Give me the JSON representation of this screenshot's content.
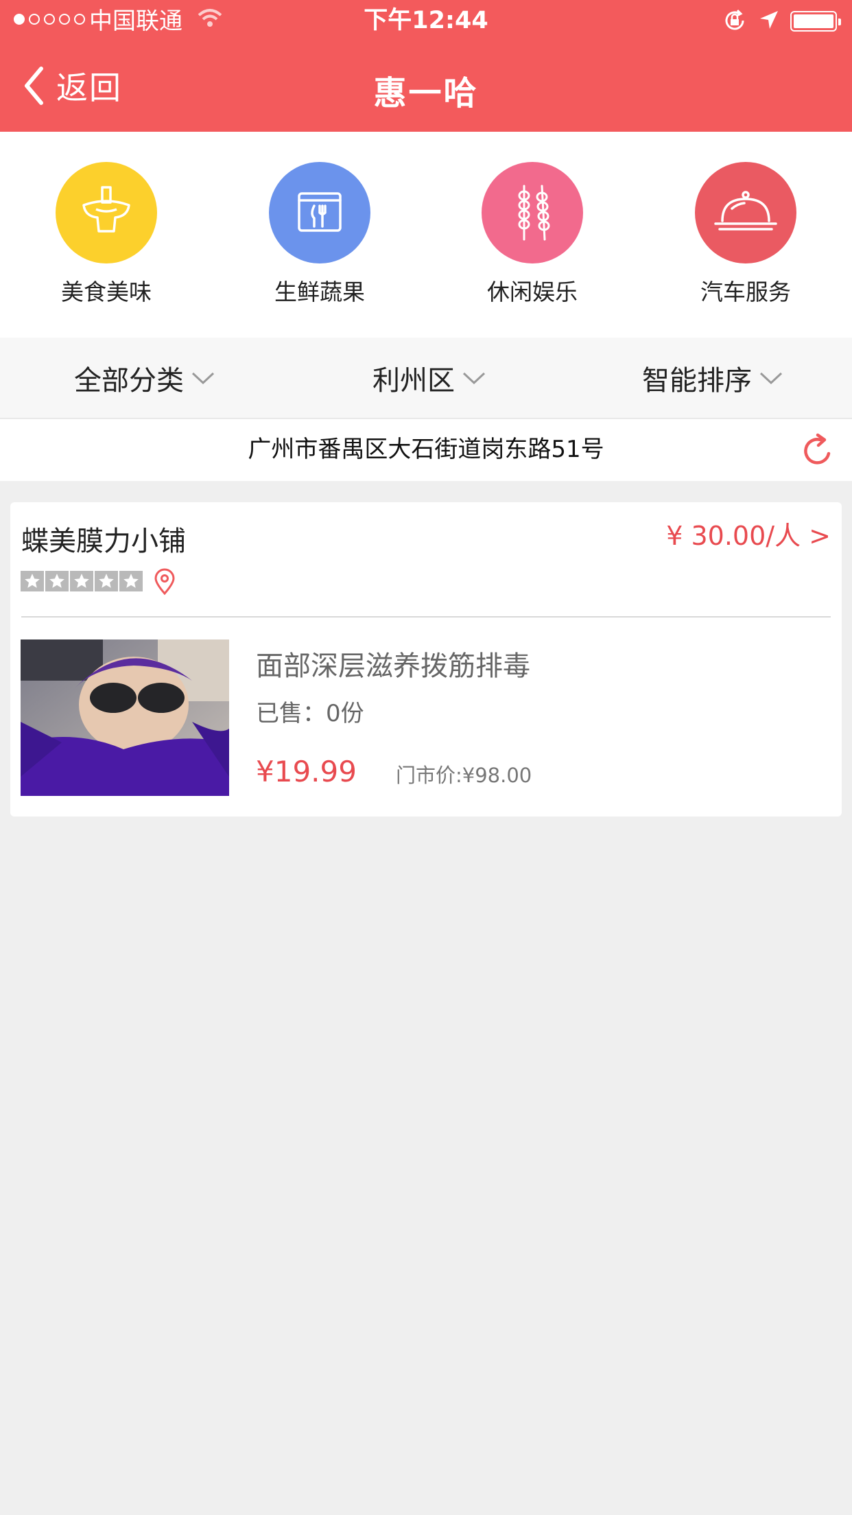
{
  "status_bar": {
    "carrier": "中国联通",
    "time": "下午12:44"
  },
  "nav": {
    "back_label": "返回",
    "title": "惠一哈"
  },
  "categories": [
    {
      "label": "美食美味",
      "icon": "hotpot-icon",
      "color": "#fcd02c"
    },
    {
      "label": "生鲜蔬果",
      "icon": "menu-cutlery-icon",
      "color": "#6b93ec"
    },
    {
      "label": "休闲娱乐",
      "icon": "skewers-icon",
      "color": "#f26a8d"
    },
    {
      "label": "汽车服务",
      "icon": "cloche-icon",
      "color": "#ea5a62"
    }
  ],
  "filters": {
    "category": "全部分类",
    "district": "利州区",
    "sort": "智能排序"
  },
  "address": "广州市番禺区大石街道岗东路51号",
  "shop": {
    "name": "蝶美膜力小铺",
    "price_per_person": "¥ 30.00/人 >",
    "rating": 0,
    "rating_max": 5,
    "deal": {
      "title": "面部深层滋养拨筋排毒",
      "sold": "已售：0份",
      "price": "¥19.99",
      "original_price": "门市价:¥98.00"
    }
  },
  "colors": {
    "brand": "#f35a5c",
    "price": "#e84a4f",
    "background": "#efefef"
  }
}
